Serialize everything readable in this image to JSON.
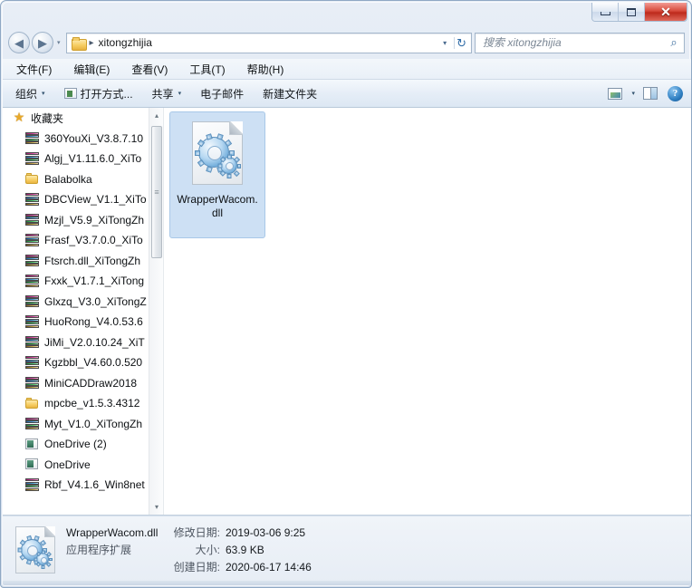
{
  "window": {
    "controls": {
      "minimize_label": "–",
      "maximize_label": "",
      "close_label": "✕"
    }
  },
  "addressbar": {
    "back_glyph": "◀",
    "forward_glyph": "▶",
    "nav_dropdown_glyph": "▾",
    "folder_icon": "folder-icon",
    "crumb_separator": "▸",
    "current_path": "xitongzhijia",
    "dropdown_glyph": "▾",
    "refresh_glyph": "↻"
  },
  "search": {
    "placeholder": "搜索 xitongzhijia",
    "value": "",
    "icon_glyph": "⌕"
  },
  "menubar": {
    "items": [
      {
        "label": "文件(F)",
        "name": "menu-file"
      },
      {
        "label": "编辑(E)",
        "name": "menu-edit"
      },
      {
        "label": "查看(V)",
        "name": "menu-view"
      },
      {
        "label": "工具(T)",
        "name": "menu-tools"
      },
      {
        "label": "帮助(H)",
        "name": "menu-help"
      }
    ]
  },
  "toolbar": {
    "organize_label": "组织",
    "openwith_label": "打开方式...",
    "share_label": "共享",
    "email_label": "电子邮件",
    "newfolder_label": "新建文件夹",
    "caret_glyph": "▾",
    "help_label": "?"
  },
  "navpane": {
    "scroll": {
      "up_glyph": "▴",
      "down_glyph": "▾",
      "thumb_grip": "≡"
    },
    "items": [
      {
        "label": "收藏夹",
        "icon": "star-icon",
        "type": "header"
      },
      {
        "label": "360YouXi_V3.8.7.10",
        "icon": "winrar-archive-icon",
        "type": "archive"
      },
      {
        "label": "Algj_V1.11.6.0_XiTo",
        "icon": "winrar-archive-icon",
        "type": "archive"
      },
      {
        "label": "Balabolka",
        "icon": "folder-icon",
        "type": "folder"
      },
      {
        "label": "DBCView_V1.1_XiTo",
        "icon": "winrar-archive-icon",
        "type": "archive"
      },
      {
        "label": "Mzjl_V5.9_XiTongZh",
        "icon": "winrar-archive-icon",
        "type": "archive"
      },
      {
        "label": "Frasf_V3.7.0.0_XiTo",
        "icon": "winrar-archive-icon",
        "type": "archive"
      },
      {
        "label": "Ftsrch.dll_XiTongZh",
        "icon": "winrar-archive-icon",
        "type": "archive"
      },
      {
        "label": "Fxxk_V1.7.1_XiTong",
        "icon": "winrar-archive-icon",
        "type": "archive"
      },
      {
        "label": "Glxzq_V3.0_XiTongZ",
        "icon": "winrar-archive-icon",
        "type": "archive"
      },
      {
        "label": "HuoRong_V4.0.53.6",
        "icon": "winrar-archive-icon",
        "type": "archive"
      },
      {
        "label": "JiMi_V2.0.10.24_XiT",
        "icon": "winrar-archive-icon",
        "type": "archive"
      },
      {
        "label": "Kgzbbl_V4.60.0.520",
        "icon": "winrar-archive-icon",
        "type": "archive"
      },
      {
        "label": "MiniCADDraw2018",
        "icon": "winrar-archive-icon",
        "type": "archive"
      },
      {
        "label": "mpcbe_v1.5.3.4312",
        "icon": "folder-icon",
        "type": "folder"
      },
      {
        "label": "Myt_V1.0_XiTongZh",
        "icon": "winrar-archive-icon",
        "type": "archive"
      },
      {
        "label": "OneDrive (2)",
        "icon": "app-shortcut-icon",
        "type": "app"
      },
      {
        "label": "OneDrive",
        "icon": "app-shortcut-icon",
        "type": "app"
      },
      {
        "label": "Rbf_V4.1.6_Win8net",
        "icon": "winrar-archive-icon",
        "type": "archive"
      }
    ]
  },
  "filelist": {
    "selected_item": {
      "name": "WrapperWacom.dll",
      "icon": "dll-gear-icon"
    }
  },
  "details": {
    "icon": "dll-gear-icon",
    "file_name": "WrapperWacom.dll",
    "file_type": "应用程序扩展",
    "fields": [
      {
        "key": "修改日期:",
        "value": "2019-03-06 9:25"
      },
      {
        "key": "大小:",
        "value": "63.9 KB"
      },
      {
        "key": "创建日期:",
        "value": "2020-06-17 14:46"
      }
    ]
  },
  "colors": {
    "selection": "#cde0f4",
    "selection_border": "#a8c8e8",
    "close_button": "#d84b3c",
    "frame": "#dce6f2"
  }
}
